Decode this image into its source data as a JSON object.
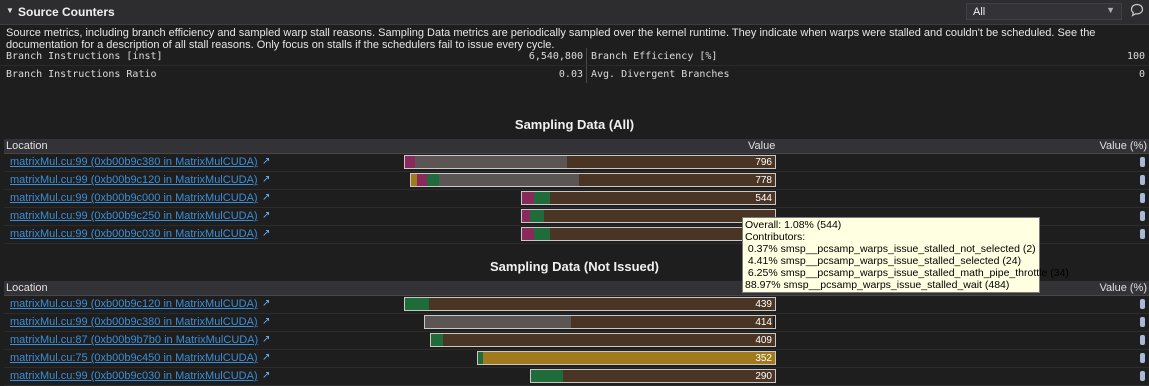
{
  "header": {
    "title": "Source Counters",
    "filter_value": "All"
  },
  "description": "Source metrics, including branch efficiency and sampled warp stall reasons. Sampling Data metrics are periodically sampled over the kernel runtime. They indicate when warps were stalled and couldn't be scheduled. See the documentation for a description of all stall reasons. Only focus on stalls if the schedulers fail to issue every cycle.",
  "metrics": [
    {
      "label_left": "Branch Instructions [inst]",
      "value_left": "6,540,800",
      "label_right": "Branch Efficiency [%]",
      "value_right": "100"
    },
    {
      "label_left": "Branch Instructions Ratio",
      "value_left": "0.03",
      "label_right": "Avg. Divergent Branches",
      "value_right": "0"
    }
  ],
  "sampling_all": {
    "title": "Sampling Data (All)",
    "columns": [
      "Location",
      "Value",
      "Value (%)"
    ],
    "rows": [
      {
        "location": "matrixMul.cu:99 (0xb00b9c380 in MatrixMulCUDA)",
        "value": "796"
      },
      {
        "location": "matrixMul.cu:99 (0xb00b9c120 in MatrixMulCUDA)",
        "value": "778"
      },
      {
        "location": "matrixMul.cu:99 (0xb00b9c000 in MatrixMulCUDA)",
        "value": "544"
      },
      {
        "location": "matrixMul.cu:99 (0xb00b9c250 in MatrixMulCUDA)",
        "value": ""
      },
      {
        "location": "matrixMul.cu:99 (0xb00b9c030 in MatrixMulCUDA)",
        "value": ""
      }
    ]
  },
  "sampling_not_issued": {
    "title": "Sampling Data (Not Issued)",
    "columns": [
      "Location",
      "",
      "Value (%)"
    ],
    "rows": [
      {
        "location": "matrixMul.cu:99 (0xb00b9c120 in MatrixMulCUDA)",
        "value": "439"
      },
      {
        "location": "matrixMul.cu:99 (0xb00b9c380 in MatrixMulCUDA)",
        "value": "414"
      },
      {
        "location": "matrixMul.cu:87 (0xb00b9b7b0 in MatrixMulCUDA)",
        "value": "409"
      },
      {
        "location": "matrixMul.cu:75 (0xb00b9c450 in MatrixMulCUDA)",
        "value": "352"
      },
      {
        "location": "matrixMul.cu:99 (0xb00b9c030 in MatrixMulCUDA)",
        "value": "290"
      }
    ]
  },
  "tooltip": {
    "lines": [
      "Overall: 1.08% (544)",
      "Contributors:",
      " 0.37% smsp__pcsamp_warps_issue_stalled_not_selected (2)",
      " 4.41% smsp__pcsamp_warps_issue_stalled_selected (24)",
      " 6.25% smsp__pcsamp_warps_issue_stalled_math_pipe_throttle (34)",
      "88.97% smsp__pcsamp_warps_issue_stalled_wait (484)"
    ]
  },
  "ext_link_glyph": "↗",
  "colors": {
    "link": "#3b8ed8",
    "bar_wait": "#4a3524",
    "bar_gray": "#5b5553",
    "bar_green": "#1f6b3a",
    "bar_pink": "#8a2a5a",
    "bar_gold": "#a07a1c",
    "tooltip_bg": "#ffffe1"
  }
}
